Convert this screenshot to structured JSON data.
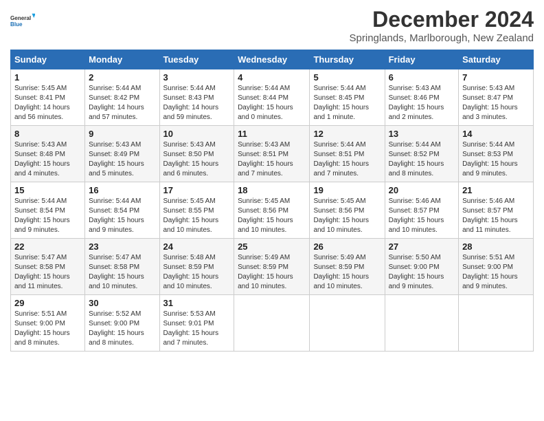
{
  "logo": {
    "line1": "General",
    "line2": "Blue"
  },
  "title": "December 2024",
  "subtitle": "Springlands, Marlborough, New Zealand",
  "calendar": {
    "headers": [
      "Sunday",
      "Monday",
      "Tuesday",
      "Wednesday",
      "Thursday",
      "Friday",
      "Saturday"
    ],
    "weeks": [
      [
        {
          "day": "1",
          "info": "Sunrise: 5:45 AM\nSunset: 8:41 PM\nDaylight: 14 hours\nand 56 minutes."
        },
        {
          "day": "2",
          "info": "Sunrise: 5:44 AM\nSunset: 8:42 PM\nDaylight: 14 hours\nand 57 minutes."
        },
        {
          "day": "3",
          "info": "Sunrise: 5:44 AM\nSunset: 8:43 PM\nDaylight: 14 hours\nand 59 minutes."
        },
        {
          "day": "4",
          "info": "Sunrise: 5:44 AM\nSunset: 8:44 PM\nDaylight: 15 hours\nand 0 minutes."
        },
        {
          "day": "5",
          "info": "Sunrise: 5:44 AM\nSunset: 8:45 PM\nDaylight: 15 hours\nand 1 minute."
        },
        {
          "day": "6",
          "info": "Sunrise: 5:43 AM\nSunset: 8:46 PM\nDaylight: 15 hours\nand 2 minutes."
        },
        {
          "day": "7",
          "info": "Sunrise: 5:43 AM\nSunset: 8:47 PM\nDaylight: 15 hours\nand 3 minutes."
        }
      ],
      [
        {
          "day": "8",
          "info": "Sunrise: 5:43 AM\nSunset: 8:48 PM\nDaylight: 15 hours\nand 4 minutes."
        },
        {
          "day": "9",
          "info": "Sunrise: 5:43 AM\nSunset: 8:49 PM\nDaylight: 15 hours\nand 5 minutes."
        },
        {
          "day": "10",
          "info": "Sunrise: 5:43 AM\nSunset: 8:50 PM\nDaylight: 15 hours\nand 6 minutes."
        },
        {
          "day": "11",
          "info": "Sunrise: 5:43 AM\nSunset: 8:51 PM\nDaylight: 15 hours\nand 7 minutes."
        },
        {
          "day": "12",
          "info": "Sunrise: 5:44 AM\nSunset: 8:51 PM\nDaylight: 15 hours\nand 7 minutes."
        },
        {
          "day": "13",
          "info": "Sunrise: 5:44 AM\nSunset: 8:52 PM\nDaylight: 15 hours\nand 8 minutes."
        },
        {
          "day": "14",
          "info": "Sunrise: 5:44 AM\nSunset: 8:53 PM\nDaylight: 15 hours\nand 9 minutes."
        }
      ],
      [
        {
          "day": "15",
          "info": "Sunrise: 5:44 AM\nSunset: 8:54 PM\nDaylight: 15 hours\nand 9 minutes."
        },
        {
          "day": "16",
          "info": "Sunrise: 5:44 AM\nSunset: 8:54 PM\nDaylight: 15 hours\nand 9 minutes."
        },
        {
          "day": "17",
          "info": "Sunrise: 5:45 AM\nSunset: 8:55 PM\nDaylight: 15 hours\nand 10 minutes."
        },
        {
          "day": "18",
          "info": "Sunrise: 5:45 AM\nSunset: 8:56 PM\nDaylight: 15 hours\nand 10 minutes."
        },
        {
          "day": "19",
          "info": "Sunrise: 5:45 AM\nSunset: 8:56 PM\nDaylight: 15 hours\nand 10 minutes."
        },
        {
          "day": "20",
          "info": "Sunrise: 5:46 AM\nSunset: 8:57 PM\nDaylight: 15 hours\nand 10 minutes."
        },
        {
          "day": "21",
          "info": "Sunrise: 5:46 AM\nSunset: 8:57 PM\nDaylight: 15 hours\nand 11 minutes."
        }
      ],
      [
        {
          "day": "22",
          "info": "Sunrise: 5:47 AM\nSunset: 8:58 PM\nDaylight: 15 hours\nand 11 minutes."
        },
        {
          "day": "23",
          "info": "Sunrise: 5:47 AM\nSunset: 8:58 PM\nDaylight: 15 hours\nand 10 minutes."
        },
        {
          "day": "24",
          "info": "Sunrise: 5:48 AM\nSunset: 8:59 PM\nDaylight: 15 hours\nand 10 minutes."
        },
        {
          "day": "25",
          "info": "Sunrise: 5:49 AM\nSunset: 8:59 PM\nDaylight: 15 hours\nand 10 minutes."
        },
        {
          "day": "26",
          "info": "Sunrise: 5:49 AM\nSunset: 8:59 PM\nDaylight: 15 hours\nand 10 minutes."
        },
        {
          "day": "27",
          "info": "Sunrise: 5:50 AM\nSunset: 9:00 PM\nDaylight: 15 hours\nand 9 minutes."
        },
        {
          "day": "28",
          "info": "Sunrise: 5:51 AM\nSunset: 9:00 PM\nDaylight: 15 hours\nand 9 minutes."
        }
      ],
      [
        {
          "day": "29",
          "info": "Sunrise: 5:51 AM\nSunset: 9:00 PM\nDaylight: 15 hours\nand 8 minutes."
        },
        {
          "day": "30",
          "info": "Sunrise: 5:52 AM\nSunset: 9:00 PM\nDaylight: 15 hours\nand 8 minutes."
        },
        {
          "day": "31",
          "info": "Sunrise: 5:53 AM\nSunset: 9:01 PM\nDaylight: 15 hours\nand 7 minutes."
        },
        {
          "day": "",
          "info": ""
        },
        {
          "day": "",
          "info": ""
        },
        {
          "day": "",
          "info": ""
        },
        {
          "day": "",
          "info": ""
        }
      ]
    ]
  }
}
